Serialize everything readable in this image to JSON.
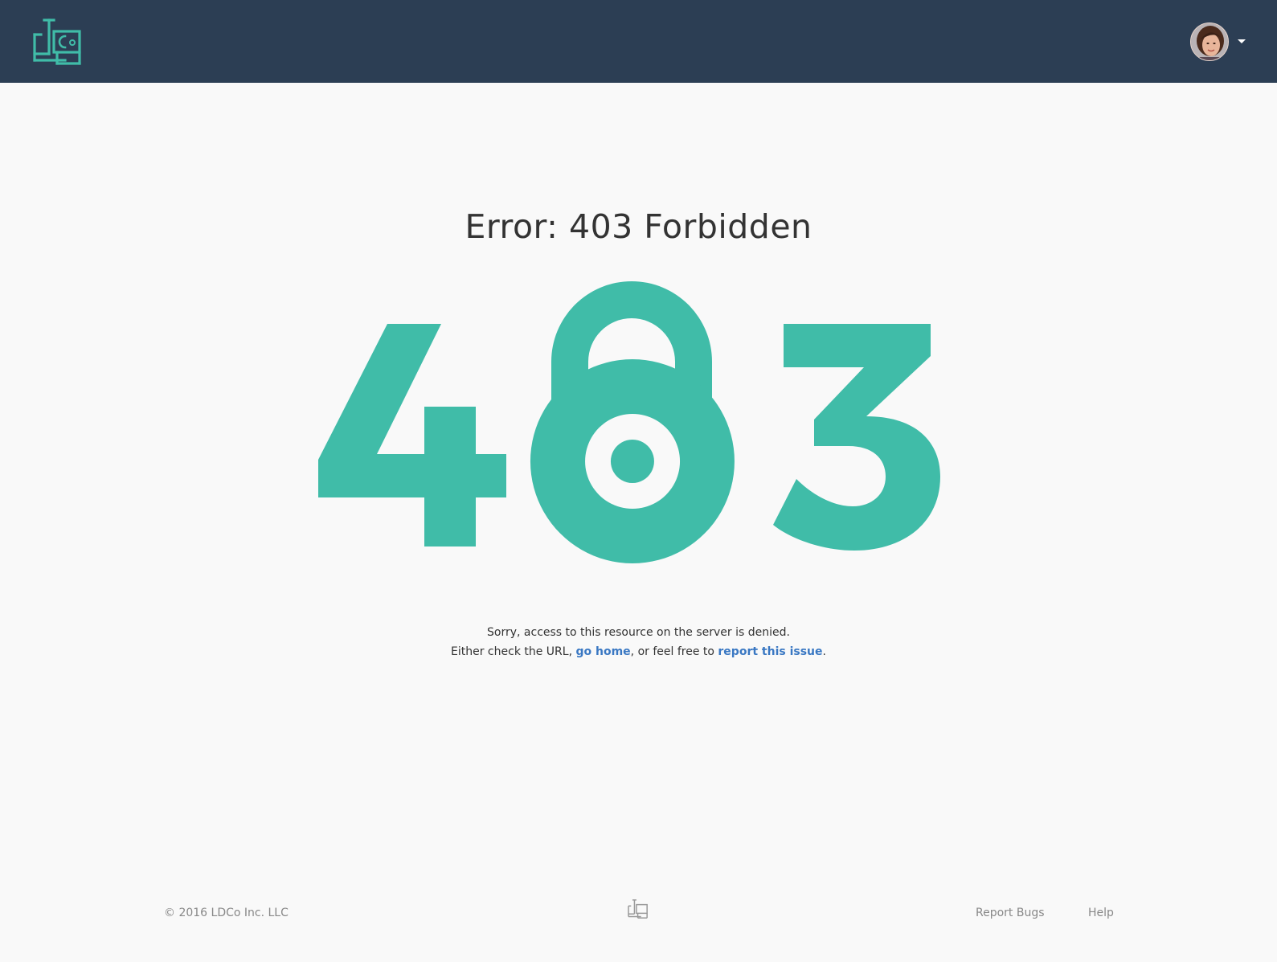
{
  "header": {
    "logo_icon": "ldco-logo-icon",
    "avatar_icon": "user-avatar-icon",
    "menu_icon": "caret-down-icon"
  },
  "main": {
    "title": "Error: 403 Forbidden",
    "graphic": {
      "digit_left": "4",
      "digit_middle_icon": "padlock-icon",
      "digit_right": "3",
      "color": "#40bca8"
    },
    "message_line1": "Sorry, access to this resource on the server is denied.",
    "message_line2_prefix": "Either check the URL, ",
    "go_home_link": "go home",
    "message_line2_middle": ", or feel free to ",
    "report_issue_link": "report this issue",
    "message_line2_suffix": "."
  },
  "footer": {
    "copyright": "© 2016 LDCo Inc. LLC",
    "logo_icon": "ldco-logo-icon",
    "links": [
      "Report Bugs",
      "Help"
    ]
  },
  "colors": {
    "header_bg": "#2c3e54",
    "accent": "#40bca8",
    "link": "#3a78c3",
    "page_bg": "#f9f9f9"
  }
}
